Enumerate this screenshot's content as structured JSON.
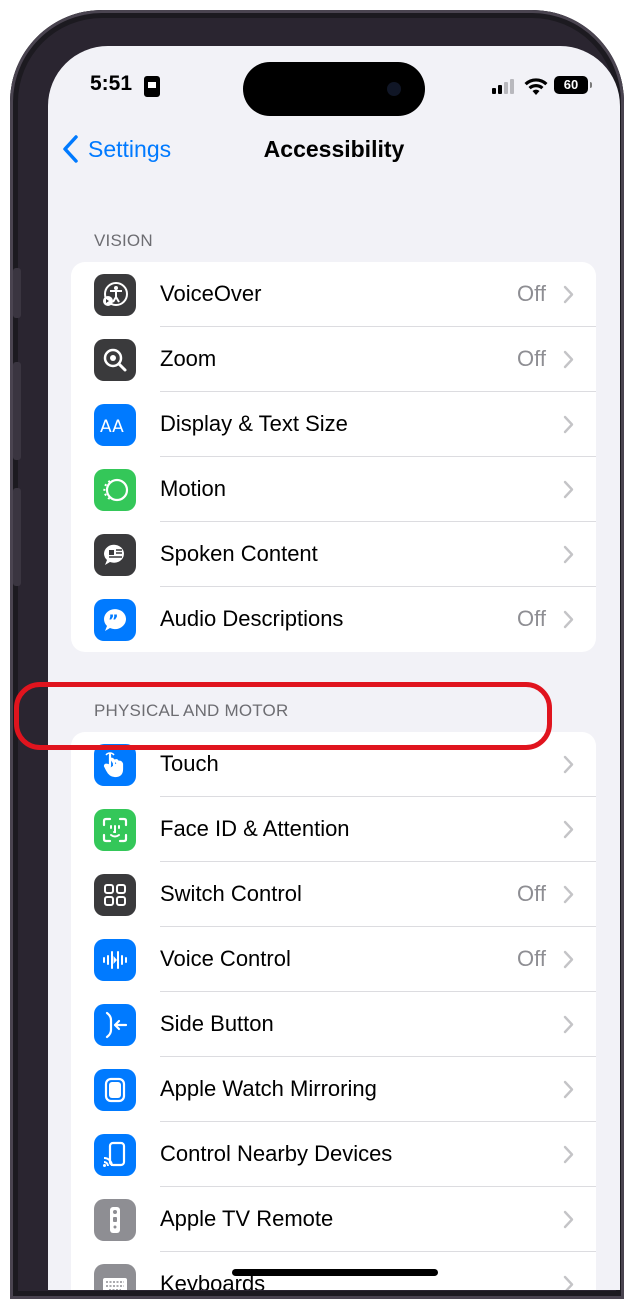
{
  "status_bar": {
    "time": "5:51",
    "battery": "60"
  },
  "nav": {
    "back_label": "Settings",
    "title": "Accessibility"
  },
  "sections": [
    {
      "header": "VISION",
      "rows": [
        {
          "label": "VoiceOver",
          "value": "Off",
          "icon": "voiceover-icon",
          "color": "#3a3a3c"
        },
        {
          "label": "Zoom",
          "value": "Off",
          "icon": "zoom-icon",
          "color": "#3a3a3c"
        },
        {
          "label": "Display & Text Size",
          "value": "",
          "icon": "display-text-size-icon",
          "color": "#007aff"
        },
        {
          "label": "Motion",
          "value": "",
          "icon": "motion-icon",
          "color": "#34c759"
        },
        {
          "label": "Spoken Content",
          "value": "",
          "icon": "spoken-content-icon",
          "color": "#3a3a3c"
        },
        {
          "label": "Audio Descriptions",
          "value": "Off",
          "icon": "audio-descriptions-icon",
          "color": "#007aff"
        }
      ]
    },
    {
      "header": "PHYSICAL AND MOTOR",
      "rows": [
        {
          "label": "Touch",
          "value": "",
          "icon": "touch-hand-icon",
          "color": "#007aff"
        },
        {
          "label": "Face ID & Attention",
          "value": "",
          "icon": "face-id-icon",
          "color": "#34c759"
        },
        {
          "label": "Switch Control",
          "value": "Off",
          "icon": "switch-control-icon",
          "color": "#3a3a3c"
        },
        {
          "label": "Voice Control",
          "value": "Off",
          "icon": "voice-control-icon",
          "color": "#007aff"
        },
        {
          "label": "Side Button",
          "value": "",
          "icon": "side-button-icon",
          "color": "#007aff"
        },
        {
          "label": "Apple Watch Mirroring",
          "value": "",
          "icon": "apple-watch-mirroring-icon",
          "color": "#007aff"
        },
        {
          "label": "Control Nearby Devices",
          "value": "",
          "icon": "control-nearby-devices-icon",
          "color": "#007aff"
        },
        {
          "label": "Apple TV Remote",
          "value": "",
          "icon": "apple-tv-remote-icon",
          "color": "#8e8e93"
        },
        {
          "label": "Keyboards",
          "value": "",
          "icon": "keyboard-icon",
          "color": "#8e8e93"
        }
      ]
    }
  ],
  "highlight_color": "#e0141e"
}
